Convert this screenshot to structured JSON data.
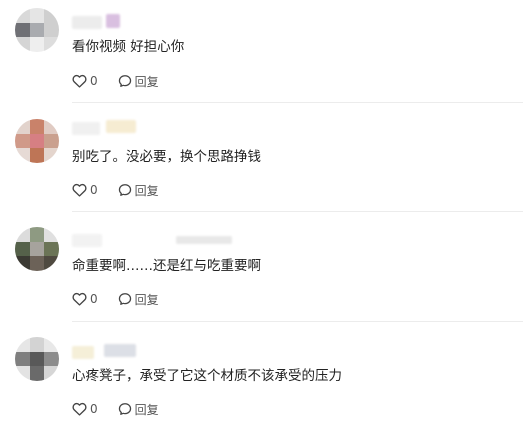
{
  "comments": [
    {
      "text": "看你视频 好担心你",
      "likes": "0",
      "reply_label": "回复",
      "avatar_colors": [
        "#d9d9d9",
        "#e5e5e5",
        "#cfcfcf",
        "#6f7075",
        "#a9abaf",
        "#cfcfcf",
        "#d5d5d5",
        "#eeeeee",
        "#dddddd"
      ],
      "name_colors": [
        "#ececec",
        "#d9bfe0"
      ]
    },
    {
      "text": "别吃了。没必要，换个思路挣钱",
      "likes": "0",
      "reply_label": "回复",
      "avatar_colors": [
        "#e2d3cc",
        "#c9826a",
        "#e0cbc3",
        "#d09a89",
        "#d67f83",
        "#caa08e",
        "#e6dad5",
        "#be7556",
        "#e4d5cd"
      ],
      "name_colors": [
        "#f0f0f0",
        "#f6ecd2"
      ]
    },
    {
      "text": "命重要啊……还是红与吃重要啊",
      "likes": "0",
      "reply_label": "回复",
      "avatar_colors": [
        "#dcdcdc",
        "#8e9a82",
        "#e0e0e0",
        "#55614a",
        "#a6a39d",
        "#6b7456",
        "#3b3a33",
        "#6c6258",
        "#4f4a40"
      ],
      "name_colors": [
        "#f2f2f2",
        "#e8e8e8"
      ]
    },
    {
      "text": "心疼凳子，承受了它这个材质不该承受的压力",
      "likes": "0",
      "reply_label": "回复",
      "avatar_colors": [
        "#e6e6e6",
        "#d3d3d3",
        "#e8e8e8",
        "#7f7f7f",
        "#595959",
        "#8c8c8c",
        "#e3e3e3",
        "#6a6a6a",
        "#d6d6d6"
      ],
      "name_colors": [
        "#f5efd8",
        "#dcdfe6"
      ]
    }
  ]
}
